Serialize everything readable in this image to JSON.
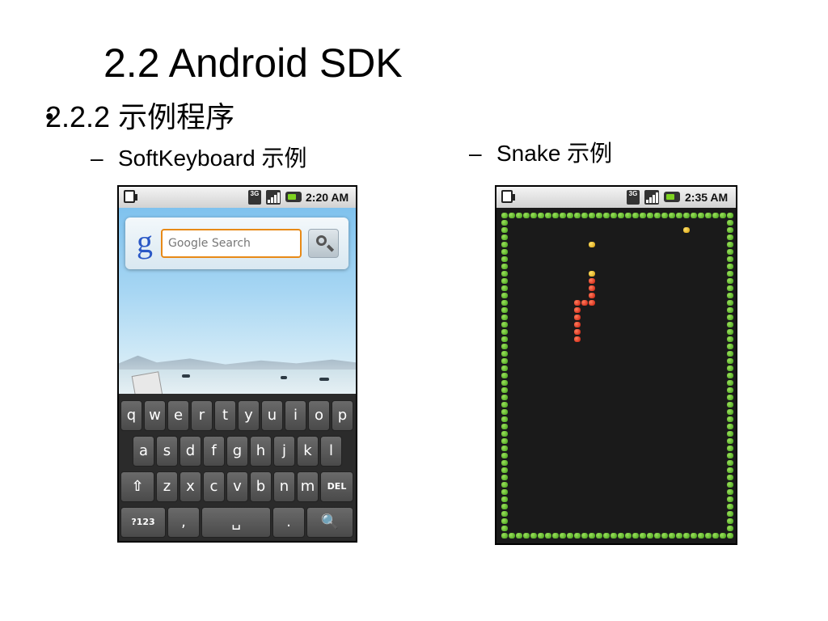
{
  "slide": {
    "title": "2.2 Android SDK",
    "bullet_marker": "•",
    "bullet": "2.2.2  示例程序",
    "dash": "–",
    "sub_left": "SoftKeyboard 示例",
    "sub_right": "Snake 示例"
  },
  "phone_keyboard": {
    "status_time": "2:20 AM",
    "status_3g": "3G",
    "google_logo": "g",
    "search_placeholder": "Google Search",
    "keys_row1": [
      "q",
      "w",
      "e",
      "r",
      "t",
      "y",
      "u",
      "i",
      "o",
      "p"
    ],
    "keys_row2": [
      "a",
      "s",
      "d",
      "f",
      "g",
      "h",
      "j",
      "k",
      "l"
    ],
    "keys_row3": [
      "⇧",
      "z",
      "x",
      "c",
      "v",
      "b",
      "n",
      "m",
      "DEL"
    ],
    "keys_row4": [
      "?123",
      ",",
      "␣",
      ".",
      "🔍"
    ]
  },
  "phone_snake": {
    "status_time": "2:35 AM",
    "status_3g": "3G"
  }
}
